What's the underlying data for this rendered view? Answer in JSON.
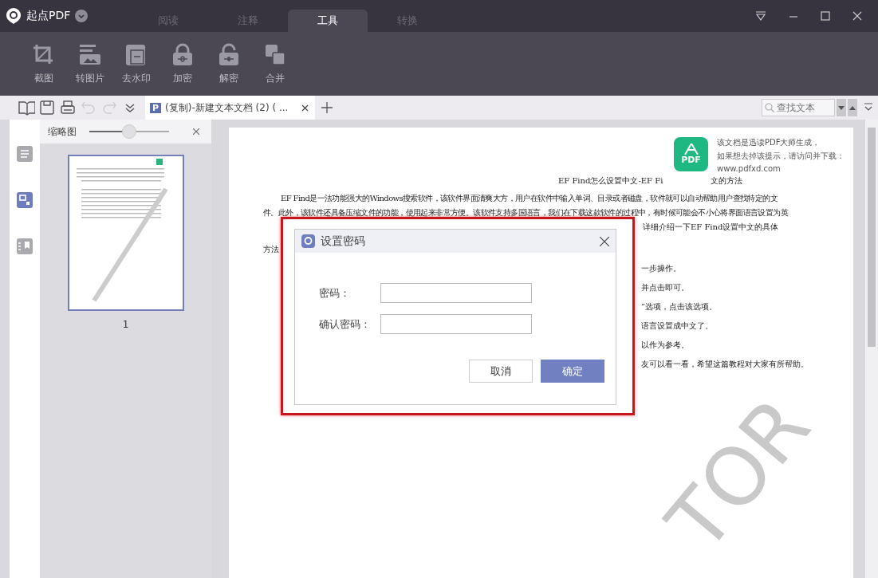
{
  "app": {
    "name": "起点PDF"
  },
  "tabs": [
    {
      "label": "阅读",
      "selected": false
    },
    {
      "label": "注释",
      "selected": false
    },
    {
      "label": "工具",
      "selected": true
    },
    {
      "label": "转换",
      "selected": false
    }
  ],
  "tools": [
    {
      "label": "截图",
      "kind": "crop"
    },
    {
      "label": "转图片",
      "kind": "image"
    },
    {
      "label": "去水印",
      "kind": "watermark"
    },
    {
      "label": "加密",
      "kind": "lock"
    },
    {
      "label": "解密",
      "kind": "unlock"
    },
    {
      "label": "合并",
      "kind": "merge"
    }
  ],
  "quick_buttons": [
    {
      "kind": "book",
      "disabled": false
    },
    {
      "kind": "save",
      "disabled": false
    },
    {
      "kind": "print",
      "disabled": false
    },
    {
      "kind": "undo",
      "disabled": true
    },
    {
      "kind": "redo",
      "disabled": true
    },
    {
      "kind": "more",
      "disabled": false
    }
  ],
  "doc_tab": {
    "badge": "P",
    "title": "(复制)-新建文本文档 (2) ( ..."
  },
  "search": {
    "placeholder": "查找文本"
  },
  "sidebar": {
    "items": [
      {
        "kind": "outline",
        "selected": false
      },
      {
        "kind": "thumbnails",
        "selected": true
      },
      {
        "kind": "bookmarks",
        "selected": false
      }
    ]
  },
  "thumbnail_panel": {
    "title": "缩略图",
    "zoom": {
      "level": 0.5
    },
    "pages": [
      {
        "number": "1",
        "selected": true
      }
    ]
  },
  "document": {
    "notice": [
      "该文档是迅读PDF大师生成，",
      "如果想去掉该提示，请访问并下载：",
      "www.pdfxd.com"
    ],
    "logo": "PDF",
    "title": "EF Find怎么设置中文-EF Fi",
    "title_tail": "文的方法",
    "lines": [
      "EF Find是一法功能强大的Windows搜索软件，该软件界面清爽大方，用户在软件中输入单词、目录或者磁盘，软件就可以自动帮助用户查找特定的文",
      "件。此外，该软件还具备压缩文件的功能，使用起来非常方便。该软件支持多国语言，我们在下载这款软件的过程中，有时候可能会不小心将界面语言设置为英"
    ],
    "line_tail": "详细介绍一下EF Find设置中文的具体",
    "heading": "方法",
    "fragments": [
      "一步操作。",
      "并点击即可。",
      "”选项，点击该选项。",
      "语言设置成中文了。",
      "以作为参考。",
      "友可以看一看，希望这篇教程对大家有所帮助。"
    ],
    "watermark": "TOR"
  },
  "dialog": {
    "title": "设置密码",
    "fields": [
      {
        "label": "密码："
      },
      {
        "label": "确认密码："
      }
    ],
    "buttons": [
      {
        "label": "取消",
        "kind": "secondary"
      },
      {
        "label": "确定",
        "kind": "primary"
      }
    ]
  }
}
